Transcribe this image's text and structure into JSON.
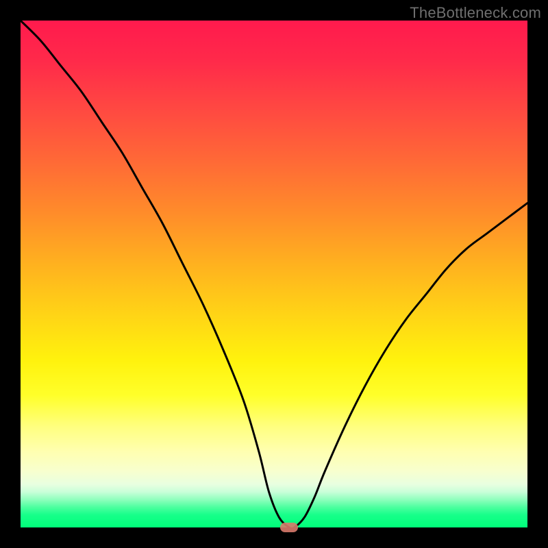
{
  "watermark": "TheBottleneck.com",
  "chart_data": {
    "type": "line",
    "title": "",
    "xlabel": "",
    "ylabel": "",
    "xlim": [
      0,
      100
    ],
    "ylim": [
      0,
      100
    ],
    "grid": false,
    "legend": false,
    "series": [
      {
        "name": "bottleneck-curve",
        "x": [
          0,
          4,
          8,
          12,
          16,
          20,
          24,
          28,
          32,
          36,
          40,
          44,
          47,
          49,
          51,
          53,
          54,
          56,
          58,
          60,
          64,
          68,
          72,
          76,
          80,
          84,
          88,
          92,
          96,
          100
        ],
        "y": [
          100,
          96,
          91,
          86,
          80,
          74,
          67,
          60,
          52,
          44,
          35,
          25,
          15,
          7,
          2,
          0,
          0,
          2,
          6,
          11,
          20,
          28,
          35,
          41,
          46,
          51,
          55,
          58,
          61,
          64
        ]
      }
    ],
    "marker": {
      "x": 53,
      "y": 0,
      "label": "optimal-point"
    },
    "background_gradient_stops": [
      {
        "pos": 0.0,
        "color": "#ff1a4d"
      },
      {
        "pos": 0.38,
        "color": "#ff8c2a"
      },
      {
        "pos": 0.67,
        "color": "#fff20d"
      },
      {
        "pos": 0.85,
        "color": "#ffffb0"
      },
      {
        "pos": 0.95,
        "color": "#8fffbd"
      },
      {
        "pos": 1.0,
        "color": "#00ff7a"
      }
    ]
  }
}
